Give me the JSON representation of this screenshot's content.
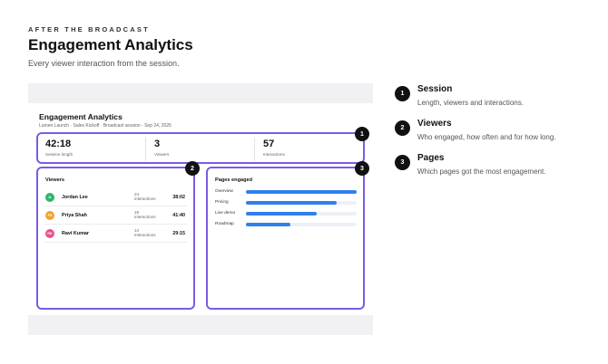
{
  "header": {
    "eyebrow": "AFTER THE BROADCAST",
    "title": "Engagement Analytics",
    "subtitle": "Every viewer interaction from the session."
  },
  "dashboard": {
    "title": "Engagement Analytics",
    "meta": "Lumen Launch · Sales Kickoff · Broadcast session · Sep 24, 2026",
    "stats": [
      {
        "value": "42:18",
        "label": "Session length"
      },
      {
        "value": "3",
        "label": "Viewers"
      },
      {
        "value": "57",
        "label": "Interactions"
      }
    ],
    "viewers": {
      "heading": "Viewers",
      "rows": [
        {
          "initials": "JL",
          "name": "Jordan Lee",
          "count": "24",
          "count_label": "interactions",
          "duration": "38:02",
          "color": "#2fb36a"
        },
        {
          "initials": "PS",
          "name": "Priya Shah",
          "count": "19",
          "count_label": "interactions",
          "duration": "41:40",
          "color": "#f0a22e"
        },
        {
          "initials": "RK",
          "name": "Ravi Kumar",
          "count": "14",
          "count_label": "interactions",
          "duration": "29:15",
          "color": "#e8508f"
        }
      ]
    },
    "pages": {
      "heading": "Pages engaged",
      "rows": [
        {
          "label": "Overview",
          "fraction": 1.0
        },
        {
          "label": "Pricing",
          "fraction": 0.82
        },
        {
          "label": "Live demo",
          "fraction": 0.64
        },
        {
          "label": "Roadmap",
          "fraction": 0.4
        }
      ]
    },
    "accent_color": "#7b5be6",
    "bar_color": "#2f80ed"
  },
  "callouts": [
    {
      "number": "1",
      "title": "Session",
      "description": "Length, viewers and interactions."
    },
    {
      "number": "2",
      "title": "Viewers",
      "description": "Who engaged, how often and for how long."
    },
    {
      "number": "3",
      "title": "Pages",
      "description": "Which pages got the most engagement."
    }
  ]
}
